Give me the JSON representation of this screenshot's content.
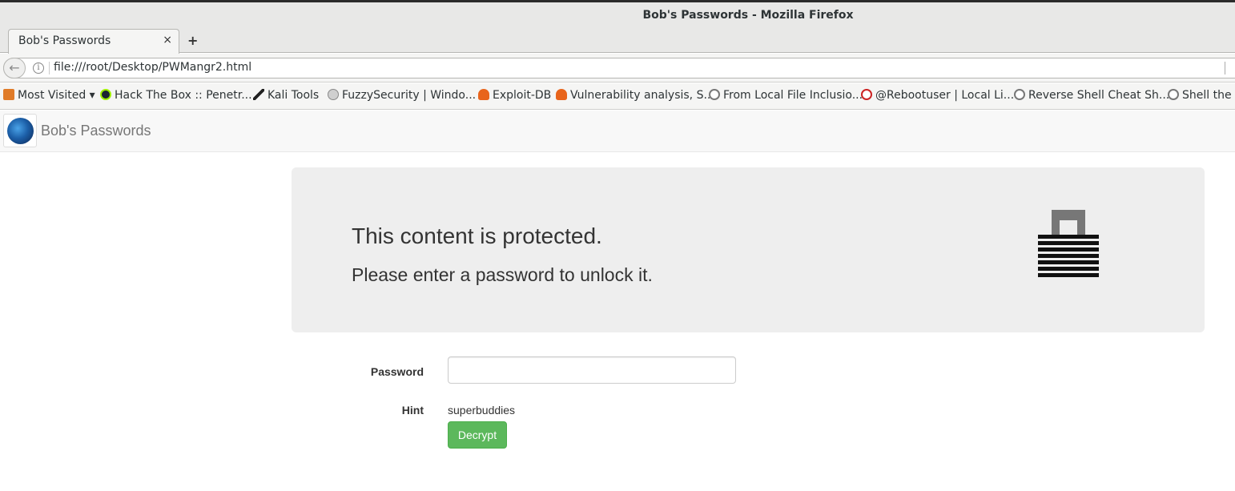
{
  "window": {
    "title": "Bob's Passwords - Mozilla Firefox"
  },
  "tabs": [
    {
      "label": "Bob's Passwords",
      "close": "×"
    }
  ],
  "newtab_glyph": "+",
  "address_bar": {
    "url": "file:///root/Desktop/PWMangr2.html"
  },
  "bookmarks": [
    {
      "label": "Most Visited ▾",
      "icon": "folder-icon",
      "color": "#e07b28"
    },
    {
      "label": "Hack The Box :: Penetr...",
      "icon": "htb-cube-icon",
      "color": "#1a2332"
    },
    {
      "label": "Kali Tools",
      "icon": "kali-dragon-icon",
      "color": "#222222"
    },
    {
      "label": "FuzzySecurity | Windo...",
      "icon": "skull-icon",
      "color": "#9a9a9a"
    },
    {
      "label": "Exploit-DB",
      "icon": "exploitdb-icon",
      "color": "#e8641b"
    },
    {
      "label": "Vulnerability analysis, S...",
      "icon": "exploitdb-icon",
      "color": "#e8641b"
    },
    {
      "label": "From Local File Inclusio...",
      "icon": "globe-icon",
      "color": "#777777"
    },
    {
      "label": "@Rebootuser | Local Li...",
      "icon": "power-icon",
      "color": "#cc2222"
    },
    {
      "label": "Reverse Shell Cheat Sh...",
      "icon": "globe-icon",
      "color": "#777777"
    },
    {
      "label": "Shell the w",
      "icon": "globe-icon",
      "color": "#777777"
    }
  ],
  "site": {
    "brand": "Bob's Passwords",
    "jumbotron": {
      "title": "This content is protected.",
      "subtitle": "Please enter a password to unlock it."
    },
    "form": {
      "password_label": "Password",
      "password_value": "",
      "hint_label": "Hint",
      "hint_value": "superbuddies",
      "submit_label": "Decrypt"
    }
  },
  "colors": {
    "button_green": "#5cb85c",
    "jumbotron_bg": "#eeeeee"
  }
}
